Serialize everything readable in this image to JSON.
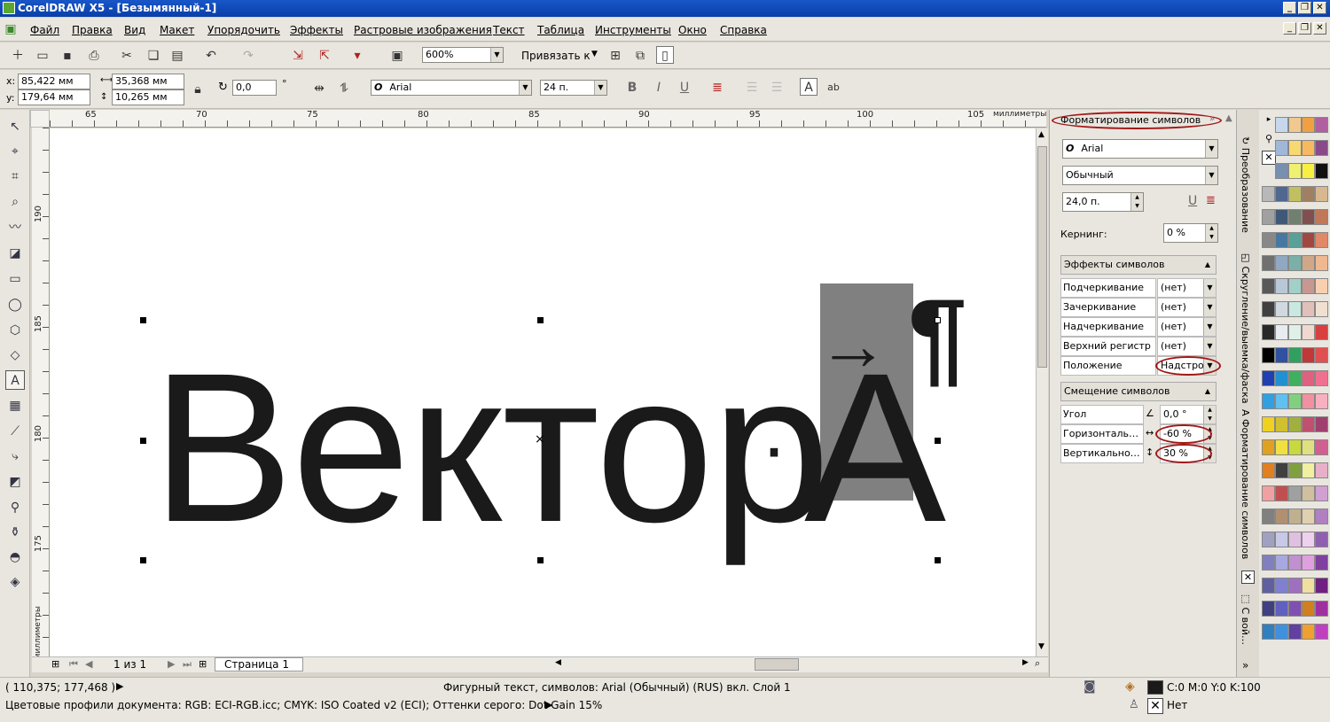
{
  "window": {
    "title": "CorelDRAW X5 - [Безымянный-1]"
  },
  "menu": [
    "Файл",
    "Правка",
    "Вид",
    "Макет",
    "Упорядочить",
    "Эффекты",
    "Растровые изображения",
    "Текст",
    "Таблица",
    "Инструменты",
    "Окно",
    "Справка"
  ],
  "toolbar": {
    "zoom": "600%",
    "snap_label": "Привязать к"
  },
  "propbar": {
    "x_label": "x:",
    "x": "85,422 мм",
    "y_label": "y:",
    "y": "179,64 мм",
    "width": "35,368 мм",
    "height": "10,265 мм",
    "angle": "0,0",
    "degree": "°",
    "font": "Arial",
    "size": "24 п.",
    "font_glyph": "O"
  },
  "ruler": {
    "h_ticks": [
      "65",
      "70",
      "75",
      "80",
      "85",
      "90",
      "95",
      "100",
      "105"
    ],
    "h_unit": "миллиметры",
    "v_ticks": [
      "190",
      "185",
      "180",
      "175"
    ],
    "v_unit": "миллиметры"
  },
  "canvas": {
    "text_main": "Вектор",
    "dot": "·",
    "text_sub": "A",
    "arrow": "→",
    "pilcrow": "¶",
    "center_mark": "×"
  },
  "docker": {
    "title": "Форматирование символов",
    "font": "Arial",
    "style": "Обычный",
    "size": "24,0 п.",
    "kerning_label": "Кернинг:",
    "kerning": "0 %",
    "effects_section": "Эффекты символов",
    "effects": [
      {
        "label": "Подчеркивание",
        "value": "(нет)"
      },
      {
        "label": "Зачеркивание",
        "value": "(нет)"
      },
      {
        "label": "Надчеркивание",
        "value": "(нет)"
      },
      {
        "label": "Верхний регистр",
        "value": "(нет)"
      },
      {
        "label": "Положение",
        "value": "Надстроч"
      }
    ],
    "shift_section": "Смещение символов",
    "shift": [
      {
        "label": "Угол",
        "value": "0,0 °"
      },
      {
        "label": "Горизонталь…",
        "value": "-60 %"
      },
      {
        "label": "Вертикально…",
        "value": "30 %"
      }
    ]
  },
  "vtabs": [
    "Преобразование",
    "Скругление/выемка/фаска",
    "Форматирование символов",
    "С вой…"
  ],
  "pager": {
    "count": "1 из 1",
    "page_tab": "Страница 1"
  },
  "status": {
    "coords": "( 110,375; 177,468 )",
    "info": "Фигурный текст, символов: Arial (Обычный) (RUS) вкл. Слой 1",
    "profiles": "Цветовые профили документа: RGB: ECI-RGB.icc; CMYK: ISO Coated v2 (ECI); Оттенки серого: Dot Gain 15%",
    "fill": "C:0 M:0 Y:0 K:100",
    "outline": "Нет"
  },
  "palette": [
    [
      "#ffffff",
      "#c8d8ec",
      "#f0c890",
      "#f0a040",
      "#b060a0"
    ],
    [
      "#e8e8e8",
      "#a0b8d8",
      "#f8d870",
      "#f8b860",
      "#8a4a8a"
    ],
    [
      "#d0d0d0",
      "#7890b0",
      "#f0f070",
      "#f8f040",
      "#101010"
    ],
    [
      "#b8b8b8",
      "#506890",
      "#c0c060",
      "#a08060",
      "#d8b890"
    ],
    [
      "#a0a0a0",
      "#405878",
      "#708070",
      "#805050",
      "#c07858"
    ],
    [
      "#888888",
      "#4878a0",
      "#58a098",
      "#a04840",
      "#e08868"
    ],
    [
      "#707070",
      "#90a8c0",
      "#7ab0a8",
      "#d0a888",
      "#f0b890"
    ],
    [
      "#585858",
      "#b8c8d8",
      "#a0d0c8",
      "#c89890",
      "#f8d0b0"
    ],
    [
      "#404040",
      "#d0d8e0",
      "#c8e8e0",
      "#e0c0b8",
      "#f0e0d0"
    ],
    [
      "#282828",
      "#e8ecf0",
      "#e0f0e8",
      "#f0d8d0",
      "#d84040"
    ],
    [
      "#000000",
      "#3050a0",
      "#30a060",
      "#c03838",
      "#e05050"
    ],
    [
      "#2040b0",
      "#2090d0",
      "#40b060",
      "#e06080",
      "#f07090"
    ],
    [
      "#30a0e0",
      "#60c0f0",
      "#80d080",
      "#f090a0",
      "#f8b0c0"
    ],
    [
      "#f0d020",
      "#d0c030",
      "#a0b040",
      "#c05070",
      "#a04070"
    ],
    [
      "#e0a020",
      "#f0e040",
      "#c8d840",
      "#e0e080",
      "#d06090"
    ],
    [
      "#e08020",
      "#404040",
      "#80a040",
      "#f0f0a0",
      "#e8b0c8"
    ],
    [
      "#f0a0a0",
      "#c05050",
      "#a0a0a0",
      "#d0c0a0",
      "#d0a0d0"
    ],
    [
      "#808080",
      "#b09070",
      "#c0b090",
      "#e0d0b0",
      "#b080c0"
    ],
    [
      "#a0a0c0",
      "#c8c8e8",
      "#e0c0e0",
      "#f0d0f0",
      "#9060b0"
    ],
    [
      "#8080c0",
      "#a8a8e0",
      "#c090d0",
      "#e0a0e0",
      "#8040a0"
    ],
    [
      "#6060a0",
      "#8080d0",
      "#a070c0",
      "#f0e0a0",
      "#702080"
    ],
    [
      "#404080",
      "#6060c0",
      "#8050b0",
      "#d08020",
      "#a030a0"
    ],
    [
      "#3080c0",
      "#4090e0",
      "#6040a0",
      "#f0a030",
      "#c040c0"
    ]
  ]
}
